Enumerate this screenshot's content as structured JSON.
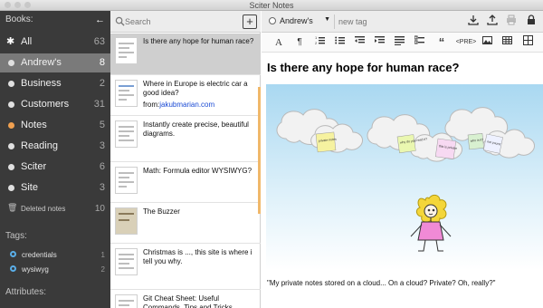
{
  "window": {
    "title": "Sciter Notes"
  },
  "sidebar": {
    "books_header": "Books:",
    "back_icon": "arrow-left-icon",
    "books": [
      {
        "label": "All",
        "count": "63",
        "icon": "asterisk-icon"
      },
      {
        "label": "Andrew's",
        "count": "8",
        "icon": "bullet-icon",
        "selected": true
      },
      {
        "label": "Business",
        "count": "2",
        "icon": "bullet-icon"
      },
      {
        "label": "Customers",
        "count": "31",
        "icon": "bullet-icon"
      },
      {
        "label": "Notes",
        "count": "5",
        "icon": "bullet-icon",
        "color": "#f0a050"
      },
      {
        "label": "Reading",
        "count": "3",
        "icon": "bullet-icon"
      },
      {
        "label": "Sciter",
        "count": "6",
        "icon": "bullet-icon"
      },
      {
        "label": "Site",
        "count": "3",
        "icon": "bullet-icon"
      },
      {
        "label": "Deleted notes",
        "count": "10",
        "icon": "trash-icon"
      }
    ],
    "tags_header": "Tags:",
    "tags": [
      {
        "label": "credentials",
        "count": "1"
      },
      {
        "label": "wysiwyg",
        "count": "2"
      }
    ],
    "attributes_header": "Attributes:"
  },
  "list": {
    "search_placeholder": "Search",
    "notes": [
      {
        "title": "Is there any hope for human race?",
        "selected": true
      },
      {
        "title": "Where in Europe is electric car a good idea?",
        "from_label": "from:",
        "from_link": "jakubmarian.com"
      },
      {
        "title": "Instantly create precise, beautiful diagrams."
      },
      {
        "title": "Math: Formula editor WYSIWYG?"
      },
      {
        "title": "The Buzzer"
      },
      {
        "title": "Christmas is ..., this site is where i tell you why."
      },
      {
        "title": "Git Cheat Sheet: Useful Commands, Tips and Tricks"
      }
    ]
  },
  "editor": {
    "book": "Andrew's",
    "new_tag_placeholder": "new tag",
    "toolbar": [
      "A",
      "¶",
      "",
      "",
      "",
      "",
      "",
      "",
      "“",
      "<PRE>",
      "",
      "",
      ""
    ],
    "title": "Is there any hope for human race?",
    "caption": "\"My private notes stored on a cloud... On a cloud? Private? Oh, really?\"",
    "stickies": [
      "private notes",
      "why do you read it?",
      "this is private",
      "who is it?",
      "not yours!"
    ]
  },
  "colors": {
    "accent": "#f0a050",
    "sidebar": "#3a3a3a",
    "link": "#1a4ad4",
    "sky": "#bfe3f5"
  }
}
